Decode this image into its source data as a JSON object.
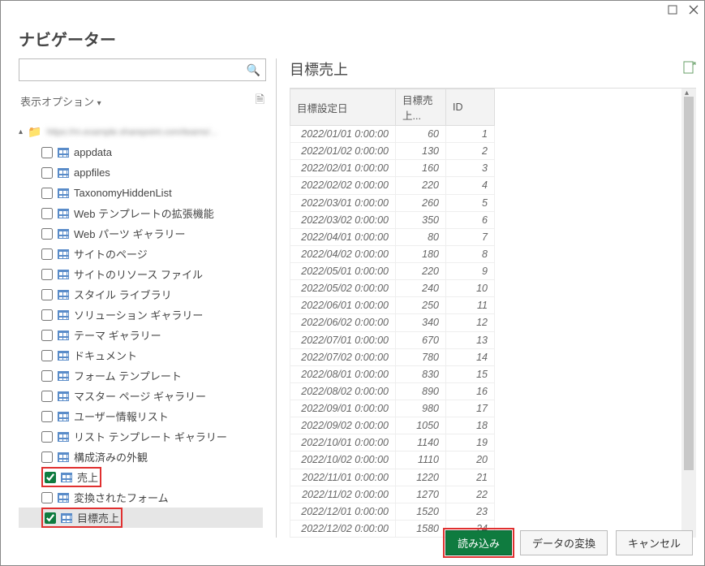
{
  "window": {
    "title": "ナビゲーター"
  },
  "search": {
    "placeholder": ""
  },
  "display_options": {
    "label": "表示オプション"
  },
  "tree": {
    "root_blur": "https://m.example.sharepoint.com/teams/...",
    "items": [
      {
        "label": "appdata",
        "checked": false
      },
      {
        "label": "appfiles",
        "checked": false
      },
      {
        "label": "TaxonomyHiddenList",
        "checked": false
      },
      {
        "label": "Web テンプレートの拡張機能",
        "checked": false
      },
      {
        "label": "Web パーツ ギャラリー",
        "checked": false
      },
      {
        "label": "サイトのページ",
        "checked": false
      },
      {
        "label": "サイトのリソース ファイル",
        "checked": false
      },
      {
        "label": "スタイル ライブラリ",
        "checked": false
      },
      {
        "label": "ソリューション ギャラリー",
        "checked": false
      },
      {
        "label": "テーマ ギャラリー",
        "checked": false
      },
      {
        "label": "ドキュメント",
        "checked": false
      },
      {
        "label": "フォーム テンプレート",
        "checked": false
      },
      {
        "label": "マスター ページ ギャラリー",
        "checked": false
      },
      {
        "label": "ユーザー情報リスト",
        "checked": false
      },
      {
        "label": "リスト テンプレート ギャラリー",
        "checked": false
      },
      {
        "label": "構成済みの外観",
        "checked": false
      },
      {
        "label": "売上",
        "checked": true,
        "highlight": true
      },
      {
        "label": "変換されたフォーム",
        "checked": false
      },
      {
        "label": "目標売上",
        "checked": true,
        "highlight": true,
        "selected": true
      }
    ]
  },
  "preview": {
    "title": "目標売上",
    "columns": [
      "目標設定日",
      "目標売上...",
      "ID"
    ],
    "rows": [
      {
        "date": "2022/01/01 0:00:00",
        "value": 60,
        "id": 1
      },
      {
        "date": "2022/01/02 0:00:00",
        "value": 130,
        "id": 2
      },
      {
        "date": "2022/02/01 0:00:00",
        "value": 160,
        "id": 3
      },
      {
        "date": "2022/02/02 0:00:00",
        "value": 220,
        "id": 4
      },
      {
        "date": "2022/03/01 0:00:00",
        "value": 260,
        "id": 5
      },
      {
        "date": "2022/03/02 0:00:00",
        "value": 350,
        "id": 6
      },
      {
        "date": "2022/04/01 0:00:00",
        "value": 80,
        "id": 7
      },
      {
        "date": "2022/04/02 0:00:00",
        "value": 180,
        "id": 8
      },
      {
        "date": "2022/05/01 0:00:00",
        "value": 220,
        "id": 9
      },
      {
        "date": "2022/05/02 0:00:00",
        "value": 240,
        "id": 10
      },
      {
        "date": "2022/06/01 0:00:00",
        "value": 250,
        "id": 11
      },
      {
        "date": "2022/06/02 0:00:00",
        "value": 340,
        "id": 12
      },
      {
        "date": "2022/07/01 0:00:00",
        "value": 670,
        "id": 13
      },
      {
        "date": "2022/07/02 0:00:00",
        "value": 780,
        "id": 14
      },
      {
        "date": "2022/08/01 0:00:00",
        "value": 830,
        "id": 15
      },
      {
        "date": "2022/08/02 0:00:00",
        "value": 890,
        "id": 16
      },
      {
        "date": "2022/09/01 0:00:00",
        "value": 980,
        "id": 17
      },
      {
        "date": "2022/09/02 0:00:00",
        "value": 1050,
        "id": 18
      },
      {
        "date": "2022/10/01 0:00:00",
        "value": 1140,
        "id": 19
      },
      {
        "date": "2022/10/02 0:00:00",
        "value": 1110,
        "id": 20
      },
      {
        "date": "2022/11/01 0:00:00",
        "value": 1220,
        "id": 21
      },
      {
        "date": "2022/11/02 0:00:00",
        "value": 1270,
        "id": 22
      },
      {
        "date": "2022/12/01 0:00:00",
        "value": 1520,
        "id": 23
      },
      {
        "date": "2022/12/02 0:00:00",
        "value": 1580,
        "id": 24
      }
    ]
  },
  "buttons": {
    "load": "読み込み",
    "transform": "データの変換",
    "cancel": "キャンセル"
  }
}
